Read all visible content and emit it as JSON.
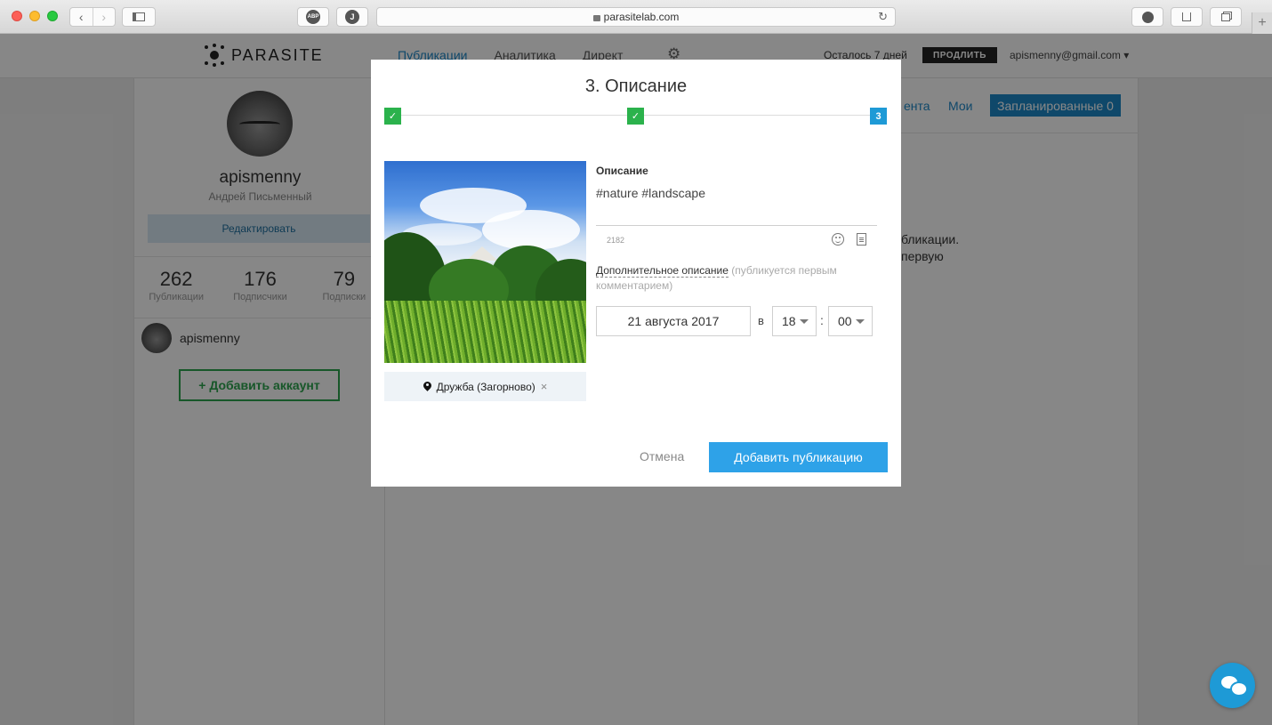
{
  "browser": {
    "url": "parasitelab.com",
    "adblock_label": "ABP",
    "back_glyph": "‹",
    "forward_glyph": "›",
    "new_tab_glyph": "+"
  },
  "site": {
    "logo_text": "PARASITE",
    "nav": [
      "Публикации",
      "Аналитика",
      "Директ"
    ],
    "trial_text": "Осталось 7 дней",
    "extend_label": "ПРОДЛИТЬ",
    "user_email": "apismenny@gmail.com ▾"
  },
  "profile": {
    "username": "apismenny",
    "full_name": "Андрей Письменный",
    "edit_label": "Редактировать",
    "stats": [
      {
        "num": "262",
        "label": "Публикации"
      },
      {
        "num": "176",
        "label": "Подписчики"
      },
      {
        "num": "79",
        "label": "Подписки"
      }
    ],
    "account_name": "apismenny",
    "add_account_label": "+ Добавить аккаунт"
  },
  "content": {
    "tab_feed": "ента",
    "tab_mine": "Мои",
    "tab_scheduled": "Запланированные 0",
    "bg_line1": "бликации.",
    "bg_line2": "первую"
  },
  "modal": {
    "title": "3. Описание",
    "steps": [
      "✓",
      "✓",
      "3"
    ],
    "location_label": "Дружба (Загорново)",
    "location_remove": "×",
    "description_label": "Описание",
    "description_value": "#nature #landscape",
    "char_count": "2182",
    "extra_desc_link": "Дополнительное описание",
    "extra_desc_hint": "(публикуется первым комментарием)",
    "date": "21 августа 2017",
    "at_label": "в",
    "hour": "18",
    "colon": ":",
    "minute": "00",
    "cancel_label": "Отмена",
    "submit_label": "Добавить публикацию"
  },
  "colors": {
    "accent": "#1e88c8",
    "success": "#2bb24c",
    "submit": "#2ea2e8"
  }
}
